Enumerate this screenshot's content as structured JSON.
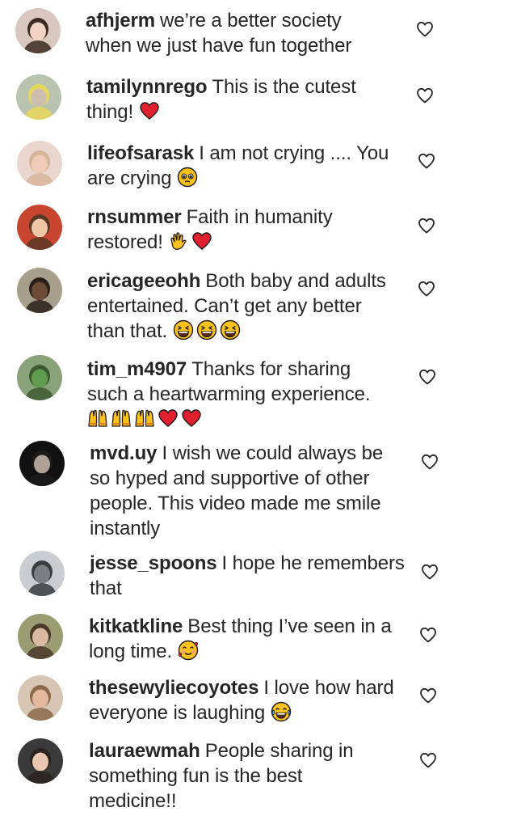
{
  "comments": [
    {
      "username": "afhjerm",
      "text": "we’re a better society when we just have fun together",
      "emojis": [],
      "avatar": {
        "bg": "#d9c8c0",
        "face": "#f2d3c4",
        "hair": "#3b2a22"
      }
    },
    {
      "username": "tamilynnrego",
      "text": "This is the cutest thing!",
      "emojis": [
        "red-heart"
      ],
      "avatar": {
        "bg": "#b8c4b0",
        "face": "#cdbfae",
        "hair": "#e8d85a"
      }
    },
    {
      "username": "lifeofsarask",
      "text": "I am not crying .... You are crying",
      "emojis": [
        "pleading-face"
      ],
      "avatar": {
        "bg": "#e8d6cf",
        "face": "#f0cbb9",
        "hair": "#d7b59a"
      }
    },
    {
      "username": "rnsummer",
      "text": "Faith in humanity restored!",
      "emojis": [
        "clapping-hands",
        "red-heart"
      ],
      "avatar": {
        "bg": "#c8452f",
        "face": "#f0c6a8",
        "hair": "#5a3a26"
      }
    },
    {
      "username": "ericageeohh",
      "text": "Both baby and adults entertained. Can’t get any better than that.",
      "emojis": [
        "laughing-face",
        "laughing-face",
        "laughing-face"
      ],
      "avatar": {
        "bg": "#a89e8c",
        "face": "#6b4a36",
        "hair": "#2a1e18"
      }
    },
    {
      "username": "tim_m4907",
      "text": "Thanks for sharing such a heartwarming experience.",
      "emojis": [
        "raising-hands",
        "raising-hands",
        "raising-hands",
        "red-heart",
        "red-heart"
      ],
      "avatar": {
        "bg": "#8aa27a",
        "face": "#5f9c4e",
        "hair": "#3d5a34"
      }
    },
    {
      "username": "mvd.uy",
      "text": "I wish we could always be so hyped and supportive of other people. This video made me smile instantly",
      "emojis": [],
      "avatar": {
        "bg": "#111111",
        "face": "#b0a196",
        "hair": "#1b1b1b"
      }
    },
    {
      "username": "jesse_spoons",
      "text": "I hope he remembers that",
      "emojis": [],
      "avatar": {
        "bg": "#c9cdd1",
        "face": "#7d7f84",
        "hair": "#3a3c40"
      }
    },
    {
      "username": "kitkatkline",
      "text": "Best thing I’ve seen in a long time.",
      "emojis": [
        "smiling-hearts-face"
      ],
      "avatar": {
        "bg": "#9a9c72",
        "face": "#d9b9a0",
        "hair": "#4a3a2a"
      }
    },
    {
      "username": "thesewyliecoyotes",
      "text": "I love how hard everyone is laughing",
      "emojis": [
        "tears-of-joy-face"
      ],
      "avatar": {
        "bg": "#d8c6b4",
        "face": "#e4b89c",
        "hair": "#8a6a4a"
      }
    },
    {
      "username": "lauraewmah",
      "text": "People sharing in something fun is the best medicine!!",
      "emojis": [],
      "avatar": {
        "bg": "#3a3a3a",
        "face": "#e9c6b0",
        "hair": "#2b2320"
      }
    }
  ],
  "colors": {
    "text": "#262626",
    "heart_outline": "#262626",
    "emoji_red": "#e0202e",
    "emoji_yellow": "#fcc21b"
  }
}
